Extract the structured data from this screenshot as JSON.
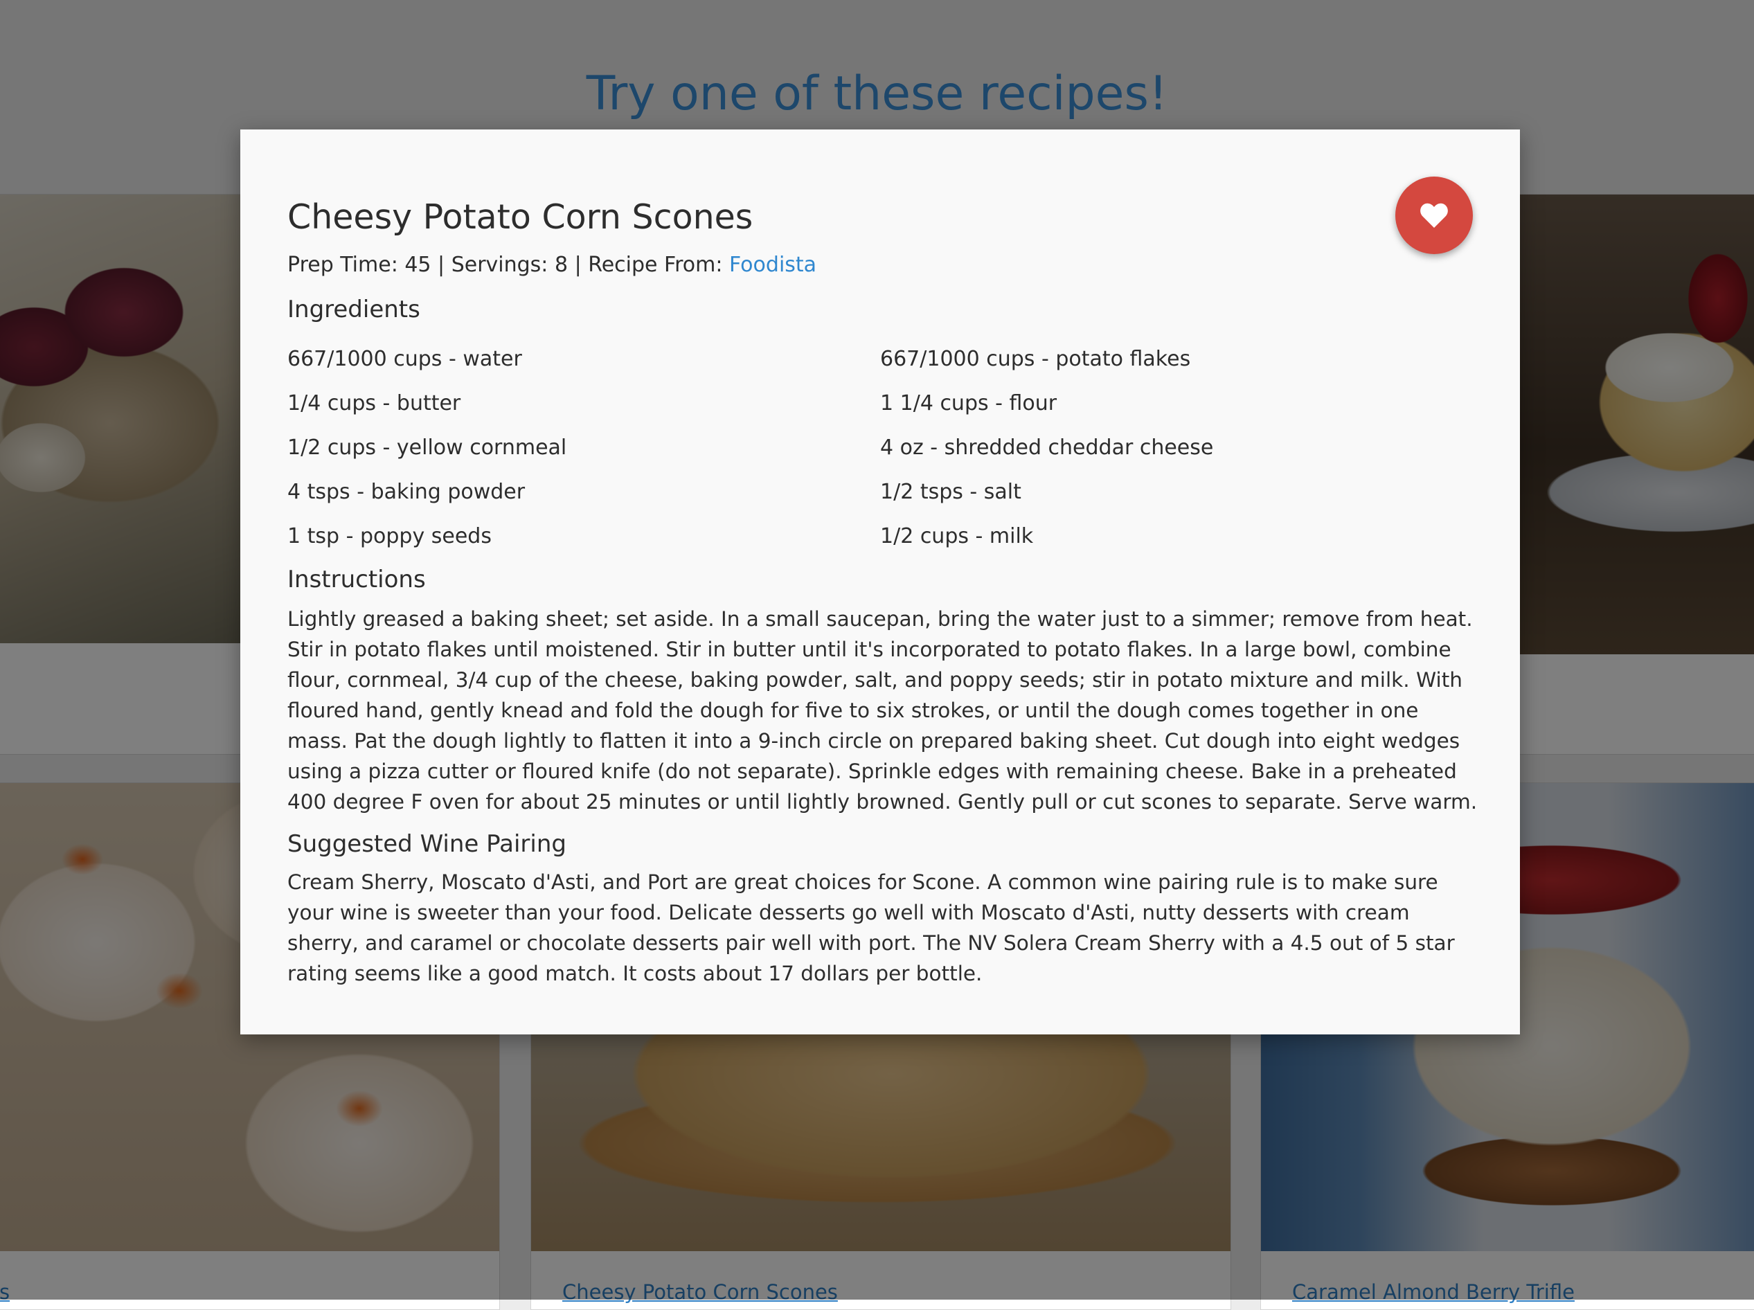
{
  "page": {
    "heading": "Try one of these recipes!",
    "cards": [
      {
        "link": "s"
      },
      {
        "link": "Cheesy Potato Corn Scones"
      },
      {
        "link": "Caramel Almond Berry Trifle"
      }
    ]
  },
  "modal": {
    "title": "Cheesy Potato Corn Scones",
    "meta_prefix": "Prep Time: 45 | Servings: 8 | Recipe From: ",
    "source_link": "Foodista",
    "favorite_icon": "heart-icon",
    "ingredients_heading": "Ingredients",
    "ingredients": [
      "667/1000 cups - water",
      "667/1000 cups - potato flakes",
      "1/4 cups - butter",
      "1 1/4 cups - flour",
      "1/2 cups - yellow cornmeal",
      "4 oz - shredded cheddar cheese",
      "4 tsps - baking powder",
      "1/2 tsps - salt",
      "1 tsp - poppy seeds",
      "1/2 cups - milk"
    ],
    "instructions_heading": "Instructions",
    "instructions": "Lightly greased a baking sheet; set aside. In a small saucepan, bring the water just to a simmer; remove from heat. Stir in potato flakes until moistened. Stir in butter until it's incorporated to potato flakes. In a large bowl, combine flour, cornmeal, 3/4 cup of the cheese, baking powder, salt, and poppy seeds; stir in potato mixture and milk. With floured hand, gently knead and fold the dough for five to six strokes, or until the dough comes together in one mass. Pat the dough lightly to flatten it into a 9-inch circle on prepared baking sheet. Cut dough into eight wedges using a pizza cutter or floured knife (do not separate). Sprinkle edges with remaining cheese. Bake in a preheated 400 degree F oven for about 25 minutes or until lightly browned. Gently pull or cut scones to separate. Serve warm.",
    "wine_heading": "Suggested Wine Pairing",
    "wine_text": "Cream Sherry, Moscato d'Asti, and Port are great choices for Scone. A common wine pairing rule is to make sure your wine is sweeter than your food. Delicate desserts go well with Moscato d'Asti, nutty desserts with cream sherry, and caramel or chocolate desserts pair well with port. The NV Solera Cream Sherry with a 4.5 out of 5 star rating seems like a good match. It costs about 17 dollars per bottle."
  },
  "colors": {
    "heading_blue": "#3a8fd6",
    "link_blue": "#2f87cf",
    "favorite_red": "#d4483f",
    "overlay": "rgba(0,0,0,0.5)"
  }
}
